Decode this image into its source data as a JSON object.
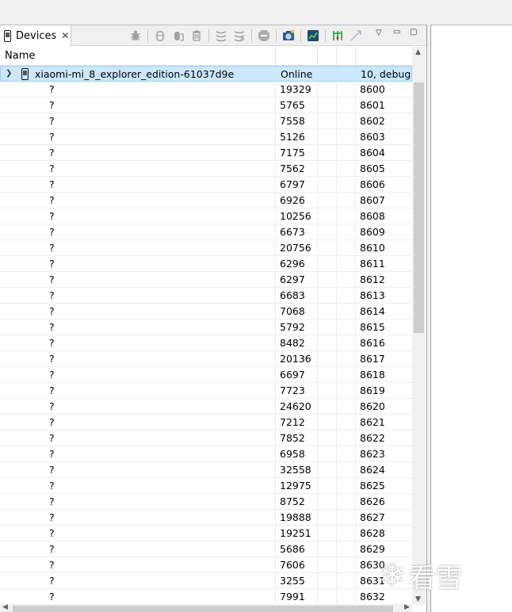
{
  "tab": {
    "title": "Devices",
    "close": "✕"
  },
  "table": {
    "header": {
      "name": "Name"
    },
    "device": {
      "name": "xiaomi-mi_8_explorer_edition-61037d9e",
      "status": "Online",
      "info": "10, debug"
    },
    "processes": [
      {
        "name": "?",
        "pid": "19329",
        "port": "8600"
      },
      {
        "name": "?",
        "pid": "5765",
        "port": "8601"
      },
      {
        "name": "?",
        "pid": "7558",
        "port": "8602"
      },
      {
        "name": "?",
        "pid": "5126",
        "port": "8603"
      },
      {
        "name": "?",
        "pid": "7175",
        "port": "8604"
      },
      {
        "name": "?",
        "pid": "7562",
        "port": "8605"
      },
      {
        "name": "?",
        "pid": "6797",
        "port": "8606"
      },
      {
        "name": "?",
        "pid": "6926",
        "port": "8607"
      },
      {
        "name": "?",
        "pid": "10256",
        "port": "8608"
      },
      {
        "name": "?",
        "pid": "6673",
        "port": "8609"
      },
      {
        "name": "?",
        "pid": "20756",
        "port": "8610"
      },
      {
        "name": "?",
        "pid": "6296",
        "port": "8611"
      },
      {
        "name": "?",
        "pid": "6297",
        "port": "8612"
      },
      {
        "name": "?",
        "pid": "6683",
        "port": "8613"
      },
      {
        "name": "?",
        "pid": "7068",
        "port": "8614"
      },
      {
        "name": "?",
        "pid": "5792",
        "port": "8615"
      },
      {
        "name": "?",
        "pid": "8482",
        "port": "8616"
      },
      {
        "name": "?",
        "pid": "20136",
        "port": "8617"
      },
      {
        "name": "?",
        "pid": "6697",
        "port": "8618"
      },
      {
        "name": "?",
        "pid": "7723",
        "port": "8619"
      },
      {
        "name": "?",
        "pid": "24620",
        "port": "8620"
      },
      {
        "name": "?",
        "pid": "7212",
        "port": "8621"
      },
      {
        "name": "?",
        "pid": "7852",
        "port": "8622"
      },
      {
        "name": "?",
        "pid": "6958",
        "port": "8623"
      },
      {
        "name": "?",
        "pid": "32558",
        "port": "8624"
      },
      {
        "name": "?",
        "pid": "12975",
        "port": "8625"
      },
      {
        "name": "?",
        "pid": "8752",
        "port": "8626"
      },
      {
        "name": "?",
        "pid": "19888",
        "port": "8627"
      },
      {
        "name": "?",
        "pid": "19251",
        "port": "8628"
      },
      {
        "name": "?",
        "pid": "5686",
        "port": "8629"
      },
      {
        "name": "?",
        "pid": "7606",
        "port": "8630"
      },
      {
        "name": "?",
        "pid": "3255",
        "port": "8631"
      },
      {
        "name": "?",
        "pid": "7991",
        "port": "8632"
      }
    ]
  },
  "toolbar": {
    "icons": [
      "debug-bug-icon",
      "heap-update-icon",
      "dump-hprof-icon",
      "gc-icon",
      "thread-update-icon",
      "method-profiling-icon",
      "stop-process-icon",
      "screen-capture-icon",
      "systrace-icon",
      "hierarchy-dump-icon",
      "ui-automator-icon"
    ]
  },
  "watermark": {
    "text": "看雪"
  },
  "colors": {
    "selection": "#cce8ff",
    "selection_border": "#99d1ff",
    "scroll_thumb": "#cdcdcd"
  }
}
